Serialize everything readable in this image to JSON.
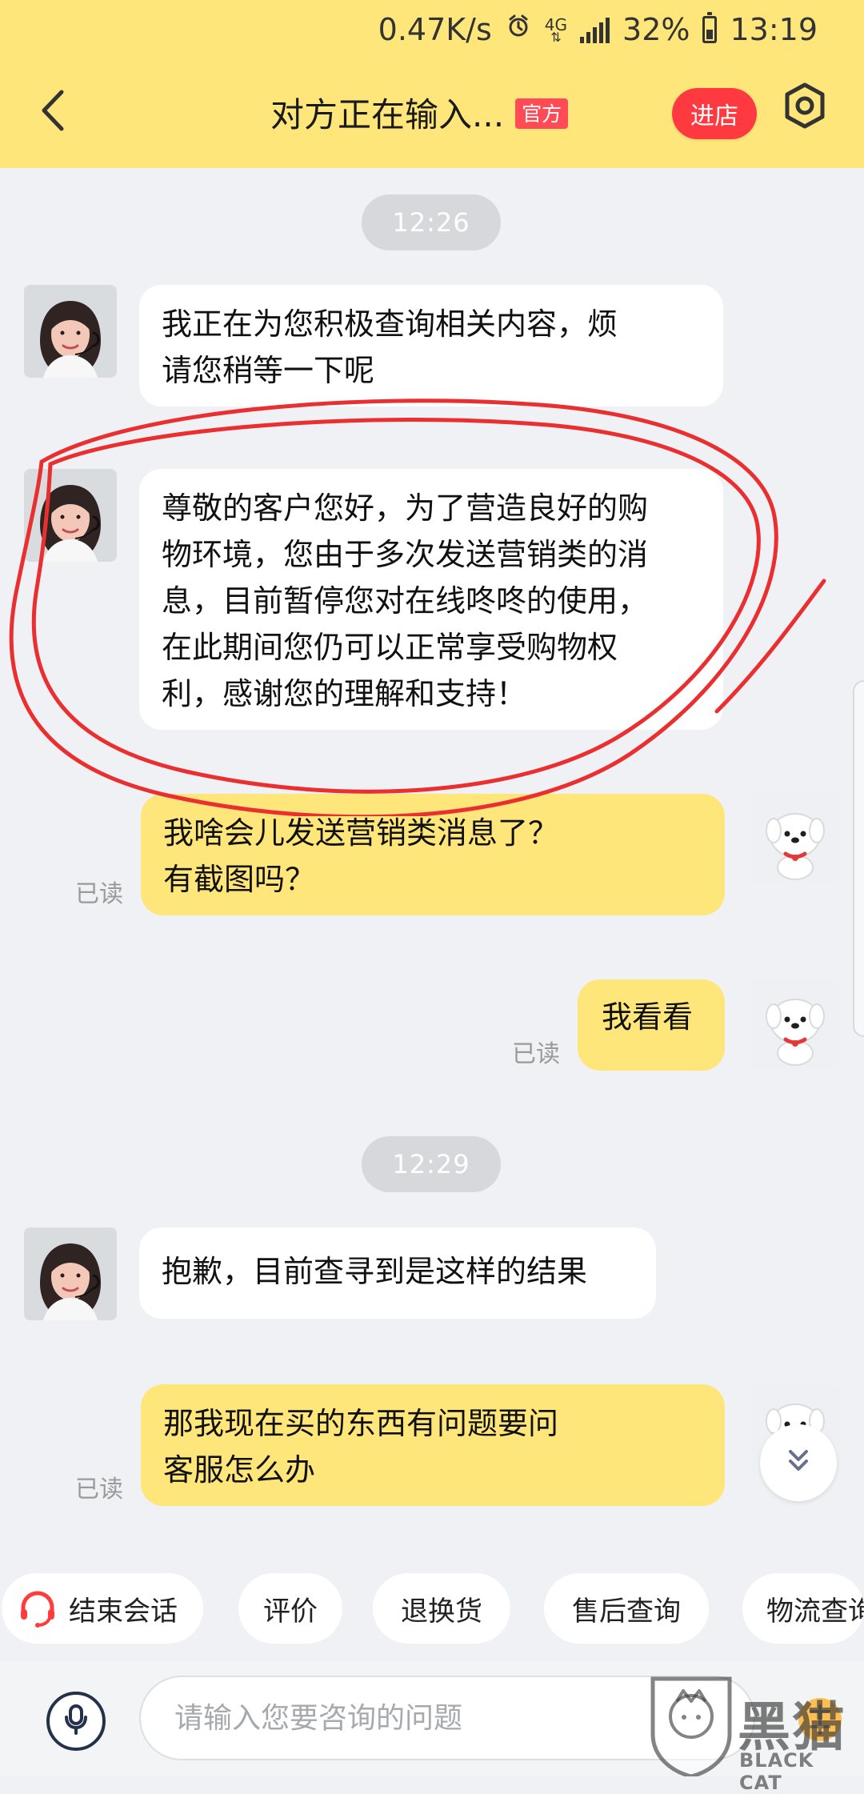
{
  "status_bar": {
    "speed": "0.47K/s",
    "network": "4G",
    "battery": "32%",
    "time": "13:19"
  },
  "header": {
    "title": "对方正在输入...",
    "badge": "官方",
    "shop_button": "进店"
  },
  "messages": {
    "timestamps": [
      "12:26",
      "12:29"
    ],
    "items": [
      {
        "lines": [
          "我正在为您积极查询相关内容，烦",
          "请您稍等一下呢"
        ]
      },
      {
        "lines": [
          "尊敬的客户您好，为了营造良好的购",
          "物环境，您由于多次发送营销类的消",
          "息，目前暂停您对在线咚咚的使用，",
          "在此期间您仍可以正常享受购物权",
          "利，感谢您的理解和支持！"
        ]
      },
      {
        "lines": [
          "我啥会儿发送营销类消息了？",
          "有截图吗？"
        ],
        "status": "已读"
      },
      {
        "lines": [
          "我看看"
        ],
        "status": "已读"
      },
      {
        "lines": [
          "抱歉，目前查寻到是这样的结果"
        ]
      },
      {
        "lines": [
          "那我现在买的东西有问题要问",
          "客服怎么办"
        ],
        "status": "已读"
      }
    ]
  },
  "quick_actions": [
    "结束会话",
    "评价",
    "退换货",
    "售后查询",
    "物流查询"
  ],
  "input": {
    "placeholder": "请输入您要咨询的问题"
  },
  "watermark": {
    "text": "黑猫",
    "subtitle": "BLACK CAT"
  },
  "icons": {
    "back": "chevron-left-icon",
    "settings": "hexagon-settings-icon",
    "scroll_down": "double-chevron-down-icon",
    "mic": "microphone-icon",
    "end_chat": "headset-icon"
  },
  "colors": {
    "accent": "#ffe67a",
    "shop_button": "#ff3940",
    "badge": "#ff4b56",
    "annotation": "#ea2f31"
  }
}
